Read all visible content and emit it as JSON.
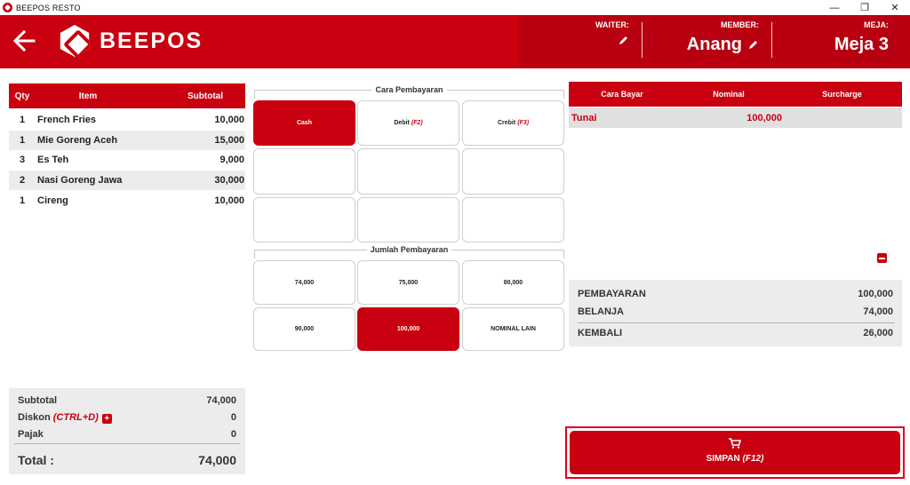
{
  "titlebar": {
    "title": "BEEPOS RESTO",
    "minimize": "—",
    "restore": "❐",
    "close": "✕"
  },
  "header": {
    "back_icon": "arrow-left-icon",
    "brand": "BEEPOS",
    "waiter_label": "WAITER:",
    "member_label": "MEMBER:",
    "member_value": "Anang",
    "meja_label": "MEJA:",
    "meja_value": "Meja 3"
  },
  "order": {
    "columns": {
      "qty": "Qty",
      "item": "Item",
      "subtotal": "Subtotal"
    },
    "rows": [
      {
        "qty": "1",
        "item": "French Fries",
        "subtotal": "10,000"
      },
      {
        "qty": "1",
        "item": "Mie Goreng Aceh",
        "subtotal": "15,000"
      },
      {
        "qty": "3",
        "item": "Es Teh",
        "subtotal": "9,000"
      },
      {
        "qty": "2",
        "item": "Nasi Goreng Jawa",
        "subtotal": "30,000"
      },
      {
        "qty": "1",
        "item": "Cireng",
        "subtotal": "10,000"
      }
    ]
  },
  "totals": {
    "subtotal_label": "Subtotal",
    "subtotal_value": "74,000",
    "diskon_label": "Diskon",
    "diskon_shortcut": "(CTRL+D)",
    "diskon_value": "0",
    "pajak_label": "Pajak",
    "pajak_value": "0",
    "total_label": "Total :",
    "total_value": "74,000"
  },
  "payment_methods": {
    "title": "Cara Pembayaran",
    "cash": "Cash",
    "debit": "Debit",
    "debit_key": "(F2)",
    "credit": "Crebit",
    "credit_key": "(F3)"
  },
  "payment_amounts": {
    "title": "Jumlah Pembayaran",
    "options": [
      "74,000",
      "75,000",
      "80,000",
      "90,000",
      "100,000",
      "NOMINAL LAIN"
    ]
  },
  "payments_table": {
    "columns": {
      "method": "Cara Bayar",
      "nominal": "Nominal",
      "surcharge": "Surcharge"
    },
    "rows": [
      {
        "method": "Tunai",
        "nominal": "100,000",
        "surcharge": ""
      }
    ]
  },
  "summary": {
    "pembayaran_label": "PEMBAYARAN",
    "pembayaran_value": "100,000",
    "belanja_label": "BELANJA",
    "belanja_value": "74,000",
    "kembali_label": "KEMBALI",
    "kembali_value": "26,000"
  },
  "save": {
    "label": "SIMPAN",
    "shortcut": "(F12)"
  },
  "colors": {
    "brand": "#c8000f",
    "row_alt": "#ececec"
  }
}
